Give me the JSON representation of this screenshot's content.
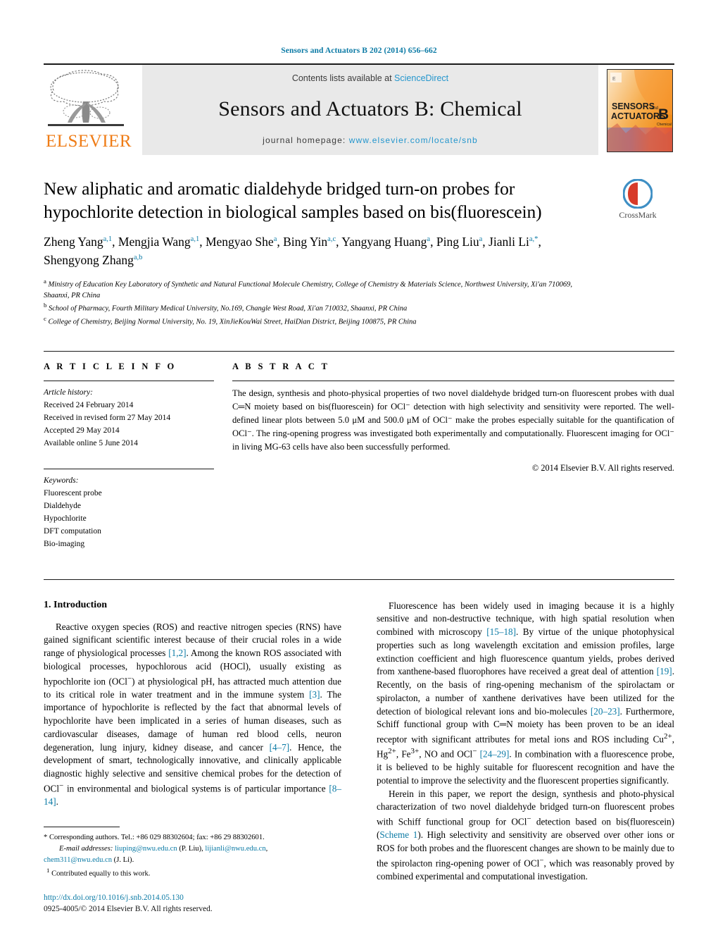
{
  "running_head": "Sensors and Actuators B 202 (2014) 656–662",
  "masthead": {
    "contents_prefix": "Contents lists available at ",
    "sciencedirect": "ScienceDirect",
    "journal_title": "Sensors and Actuators B: Chemical",
    "homepage_prefix": "journal homepage: ",
    "homepage_url": "www.elsevier.com/locate/snb",
    "publisher": "ELSEVIER",
    "cover_title_line1": "SENSORS and",
    "cover_title_line2": "ACTUATORS",
    "cover_letter": "B",
    "cover_sub": "Chemical"
  },
  "crossmark": {
    "label": "CrossMark"
  },
  "article": {
    "title": "New aliphatic and aromatic dialdehyde bridged turn-on probes for hypochlorite detection in biological samples based on bis(fluorescein)",
    "authors_line1": "Zheng Yang",
    "authors_html": "Zheng Yang<sup>a,1</sup>, Mengjia Wang<sup>a,1</sup>, Mengyao She<sup>a</sup>, Bing Yin<sup>a,c</sup>, Yangyang Huang<sup>a</sup>, Ping Liu<sup>a</sup>, Jianli Li<sup>a,*</sup>, Shengyong Zhang<sup>a,b</sup>",
    "affiliations": [
      {
        "marker": "a",
        "text": "Ministry of Education Key Laboratory of Synthetic and Natural Functional Molecule Chemistry, College of Chemistry & Materials Science, Northwest University, Xi'an 710069, Shaanxi, PR China"
      },
      {
        "marker": "b",
        "text": "School of Pharmacy, Fourth Military Medical University, No.169, Changle West Road, Xi'an 710032, Shaanxi, PR China"
      },
      {
        "marker": "c",
        "text": "College of Chemistry, Beijing Normal University, No. 19, XinJieKouWai Street, HaiDian District, Beijing 100875, PR China"
      }
    ]
  },
  "article_info": {
    "heading": "A R T I C L E   I N F O",
    "history_label": "Article history:",
    "history": [
      "Received 24 February 2014",
      "Received in revised form 27 May 2014",
      "Accepted 29 May 2014",
      "Available online 5 June 2014"
    ],
    "keywords_label": "Keywords:",
    "keywords": [
      "Fluorescent probe",
      "Dialdehyde",
      "Hypochlorite",
      "DFT computation",
      "Bio-imaging"
    ]
  },
  "abstract": {
    "heading": "A B S T R A C T",
    "text": "The design, synthesis and photo-physical properties of two novel dialdehyde bridged turn-on fluorescent probes with dual C═N moiety based on bis(fluorescein) for OCl⁻ detection with high selectivity and sensitivity were reported. The well-defined linear plots between 5.0 μM and 500.0 μM of OCl⁻ make the probes especially suitable for the quantification of OCl⁻. The ring-opening progress was investigated both experimentally and computationally. Fluorescent imaging for OCl⁻ in living MG-63 cells have also been successfully performed.",
    "copyright": "© 2014 Elsevier B.V. All rights reserved."
  },
  "body": {
    "section_heading": "1.  Introduction",
    "left_paragraph_html": "Reactive oxygen species (ROS) and reactive nitrogen species (RNS) have gained significant scientific interest because of their crucial roles in a wide range of physiological processes <span class=\"ref\">[1,2]</span>. Among the known ROS associated with biological processes, hypochlorous acid (HOCl), usually existing as hypochlorite ion (OCl<sup>−</sup>) at physiological pH, has attracted much attention due to its critical role in water treatment and in the immune system <span class=\"ref\">[3]</span>. The importance of hypochlorite is reflected by the fact that abnormal levels of hypochlorite have been implicated in a series of human diseases, such as cardiovascular diseases, damage of human red blood cells, neuron degeneration, lung injury, kidney disease, and cancer <span class=\"ref\">[4–7]</span>. Hence, the development of smart, technologically innovative, and clinically applicable diagnostic highly selective and sensitive chemical probes for the detection of OCl<sup>−</sup> in environmental and biological systems is of particular importance <span class=\"ref\">[8–14]</span>.",
    "right_paragraph1_html": "Fluorescence has been widely used in imaging because it is a highly sensitive and non-destructive technique, with high spatial resolution when combined with microscopy <span class=\"ref\">[15–18]</span>. By virtue of the unique photophysical properties such as long wavelength excitation and emission profiles, large extinction coefficient and high fluorescence quantum yields, probes derived from xanthene-based fluorophores have received a great deal of attention <span class=\"ref\">[19]</span>. Recently, on the basis of ring-opening mechanism of the spirolactam or spirolacton, a number of xanthene derivatives have been utilized for the detection of biological relevant ions and bio-molecules <span class=\"ref\">[20–23]</span>. Furthermore, Schiff functional group with C═N moiety has been proven to be an ideal receptor with significant attributes for metal ions and ROS including Cu<sup>2+</sup>, Hg<sup>2+</sup>, Fe<sup>3+</sup>, NO and OCl<sup>−</sup> <span class=\"ref\">[24–29]</span>. In combination with a fluorescence probe, it is believed to be highly suitable for fluorescent recognition and have the potential to improve the selectivity and the fluorescent properties significantly.",
    "right_paragraph2_html": "Herein in this paper, we report the design, synthesis and photo-physical characterization of two novel dialdehyde bridged turn-on fluorescent probes with Schiff functional group for OCl<sup>−</sup> detection based on bis(fluorescein) (<span class=\"ref\">Scheme 1</span>). High selectivity and sensitivity are observed over other ions or ROS for both probes and the fluorescent changes are shown to be mainly due to the spirolacton ring-opening power of OCl<sup>−</sup>, which was reasonably proved by combined experimental and computational investigation."
  },
  "footnotes": {
    "corresponding_html": "<span class=\"nowrap\">*  Corresponding authors. Tel.: +86 029 88302604; fax: +86 29 88302601.</span>",
    "email_html": "<span class=\"em\">E-mail addresses:</span> <span class=\"link\">liuping@nwu.edu.cn</span> (P. Liu), <span class=\"link\">lijianli@nwu.edu.cn</span>,",
    "email_html2": "<span class=\"link\">chem311@nwu.edu.cn</span> (J. Li).",
    "equal_contribution_html": "<sup>1</sup>  Contributed equally to this work.",
    "doi": "http://dx.doi.org/10.1016/j.snb.2014.05.130",
    "issn": "0925-4005/© 2014 Elsevier B.V. All rights reserved."
  },
  "colors": {
    "link": "#0b7aa5",
    "sciencedirect": "#2496cd",
    "elsevier_orange": "#ef7c16",
    "band_gray": "#e9e9e9"
  }
}
